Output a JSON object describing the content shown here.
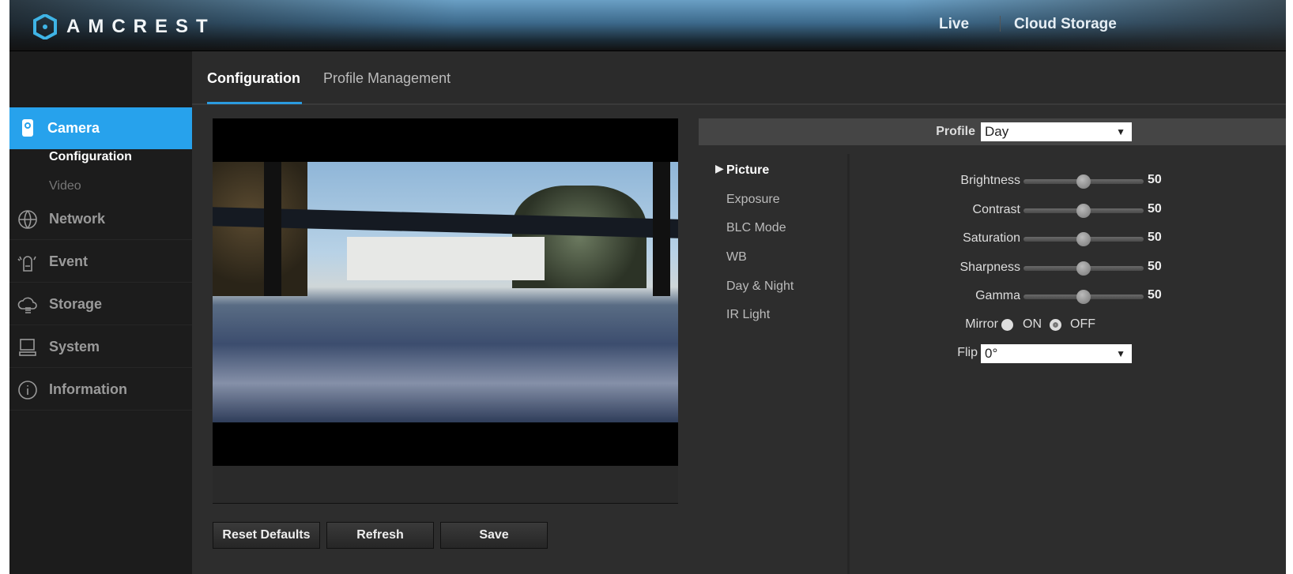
{
  "brand": {
    "name": "AMCREST",
    "accent": "#27a2ec"
  },
  "topnav": {
    "live": "Live",
    "cloud": "Cloud Storage"
  },
  "tabs": [
    {
      "label": "Configuration",
      "active": true
    },
    {
      "label": "Profile Management",
      "active": false
    }
  ],
  "sidebar": {
    "items": [
      {
        "label": "Camera",
        "icon": "camera-icon",
        "active": true,
        "sub": [
          {
            "label": "Configuration",
            "active": true
          },
          {
            "label": "Video",
            "active": false
          }
        ]
      },
      {
        "label": "Network",
        "icon": "globe-icon"
      },
      {
        "label": "Event",
        "icon": "alarm-icon"
      },
      {
        "label": "Storage",
        "icon": "cloud-storage-icon"
      },
      {
        "label": "System",
        "icon": "computer-icon"
      },
      {
        "label": "Information",
        "icon": "info-icon"
      }
    ]
  },
  "buttons": {
    "reset": "Reset Defaults",
    "refresh": "Refresh",
    "save": "Save"
  },
  "profile": {
    "label": "Profile",
    "value": "Day"
  },
  "menu": [
    "Picture",
    "Exposure",
    "BLC Mode",
    "WB",
    "Day & Night",
    "IR Light"
  ],
  "settings": [
    {
      "label": "Brightness",
      "value": "50",
      "pct": 50
    },
    {
      "label": "Contrast",
      "value": "50",
      "pct": 50
    },
    {
      "label": "Saturation",
      "value": "50",
      "pct": 50
    },
    {
      "label": "Sharpness",
      "value": "50",
      "pct": 50
    },
    {
      "label": "Gamma",
      "value": "50",
      "pct": 50
    }
  ],
  "mirror": {
    "label": "Mirror",
    "on": "ON",
    "off": "OFF",
    "selected": "OFF"
  },
  "flip": {
    "label": "Flip",
    "value": "0°"
  }
}
